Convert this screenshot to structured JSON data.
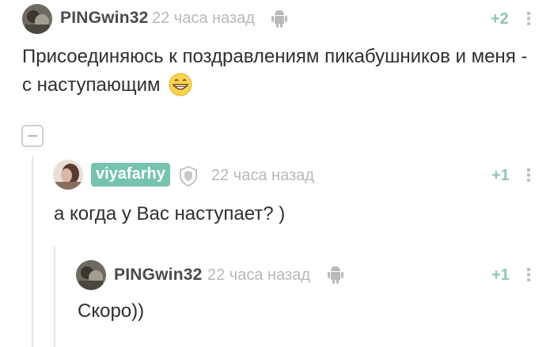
{
  "comments": [
    {
      "user": "PINGwin32",
      "time": "22 часа назад",
      "rating": "+2",
      "text": "Присоединяюсь к поздравлениям пикабушников и меня - с наступающим",
      "device_icon": "android-icon",
      "emoji": "grinning-face-emoji"
    },
    {
      "user": "viyafarhy",
      "time": "22 часа назад",
      "rating": "+1",
      "text": "а когда у Вас наступает? )",
      "badge_icon": "shield-icon"
    },
    {
      "user": "PINGwin32",
      "time": "22 часа назад",
      "rating": "+1",
      "text": "Скоро))",
      "device_icon": "android-icon"
    }
  ],
  "menu_glyph": "⋮",
  "colors": {
    "username_badge_bg": "#76c3b0",
    "rating": "#8ec6b6",
    "time": "#b8b8b8",
    "thread_line": "#e6e6e6"
  }
}
